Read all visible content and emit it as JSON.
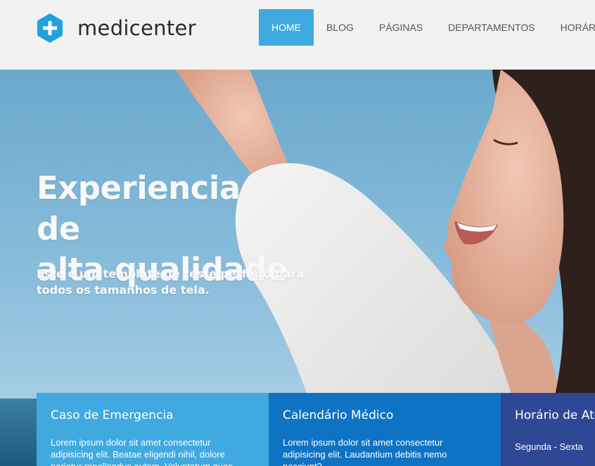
{
  "brand": {
    "name": "medicenter"
  },
  "nav": {
    "items": [
      {
        "label": "HOME",
        "active": true
      },
      {
        "label": "BLOG",
        "active": false
      },
      {
        "label": "PÁGINAS",
        "active": false
      },
      {
        "label": "DEPARTAMENTOS",
        "active": false
      },
      {
        "label": "HORÁRIOS",
        "active": false
      }
    ]
  },
  "hero": {
    "title_line1": "Experiencia de",
    "title_line2": "alta qualidade",
    "subtitle": "Este é um template de teste perfeito para todos os tamanhos de tela."
  },
  "boxes": [
    {
      "title": "Caso de Emergencia",
      "text": "Lorem ipsum dolor sit amet consectetur adipisicing elit. Beatae eligendi nihil, dolore pariatur repellendus autem. Voluptatum quos"
    },
    {
      "title": "Calendário Médico",
      "text": "Lorem ipsum dolor sit amet consectetur adipisicing elit. Laudantium debitis nemo nesciunt?"
    },
    {
      "title": "Horário de Atendimento",
      "text": "Segunda - Sexta"
    }
  ],
  "colors": {
    "accent": "#3fa9e0",
    "box_1": "#3fa9e0",
    "box_2": "#0f73c4",
    "box_3": "#2f4896",
    "header_bg": "#f2f2f2"
  },
  "icons": {
    "logo": "medical-cross-hexagon-icon"
  }
}
